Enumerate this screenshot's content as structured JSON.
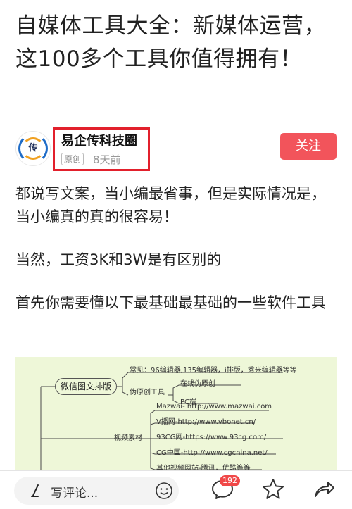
{
  "article": {
    "title": "自媒体工具大全：新媒体运营，这100多个工具你值得拥有！"
  },
  "author": {
    "avatar_char": "传",
    "name": "易企传科技圈",
    "original_tag": "原创",
    "time": "8天前",
    "follow_label": "关注"
  },
  "paragraphs": [
    "都说写文案，当小编最省事，但是实际情况是，当小编真的真的很容易！",
    "当然，工资3K和3W是有区别的",
    "首先你需要懂以下最基础最基础的一些软件工具"
  ],
  "mindmap": {
    "root": "微信图文排版",
    "items": [
      "常见：96编辑器,135编辑器，i排版，秀米编辑器等等",
      "伪原创工具",
      "在线伪原创",
      "PC端",
      "Mazwai- http://www.mazwai.com",
      "V播网-http://www.vbonet.cn/",
      "视频素材",
      "93CG网-https://www.93cg.com/",
      "CG中国-http://www.cgchina.net/",
      "其他视频网站-腾讯，优酷等等"
    ]
  },
  "bottom_bar": {
    "comment_placeholder": "写评论...",
    "comment_count": "192",
    "icons": [
      "pen-icon",
      "smile-icon",
      "comment-icon",
      "star-icon",
      "share-icon"
    ]
  },
  "colors": {
    "accent": "#f2545b",
    "highlight_border": "#e2202c",
    "badge": "#f04848",
    "mindmap_bg": "#eef7d8"
  }
}
